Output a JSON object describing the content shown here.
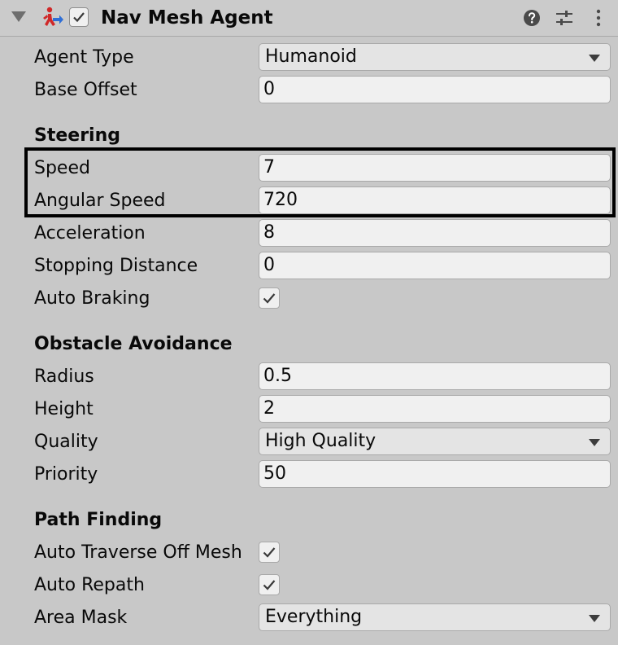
{
  "component": {
    "title": "Nav Mesh Agent",
    "enabled": true,
    "icons": [
      "foldout-arrow-icon",
      "nav-agent-icon",
      "help-icon",
      "preset-icon",
      "kebab-menu-icon"
    ]
  },
  "fields": {
    "agent_type": {
      "label": "Agent Type",
      "value": "Humanoid"
    },
    "base_offset": {
      "label": "Base Offset",
      "value": "0"
    }
  },
  "steering": {
    "title": "Steering",
    "speed": {
      "label": "Speed",
      "value": "7"
    },
    "angular_speed": {
      "label": "Angular Speed",
      "value": "720"
    },
    "acceleration": {
      "label": "Acceleration",
      "value": "8"
    },
    "stopping_distance": {
      "label": "Stopping Distance",
      "value": "0"
    },
    "auto_braking": {
      "label": "Auto Braking",
      "checked": true
    }
  },
  "obstacle_avoidance": {
    "title": "Obstacle Avoidance",
    "radius": {
      "label": "Radius",
      "value": "0.5"
    },
    "height": {
      "label": "Height",
      "value": "2"
    },
    "quality": {
      "label": "Quality",
      "value": "High Quality"
    },
    "priority": {
      "label": "Priority",
      "value": "50"
    }
  },
  "path_finding": {
    "title": "Path Finding",
    "auto_traverse": {
      "label": "Auto Traverse Off Mesh",
      "checked": true
    },
    "auto_repath": {
      "label": "Auto Repath",
      "checked": true
    },
    "area_mask": {
      "label": "Area Mask",
      "value": "Everything"
    }
  },
  "colors": {
    "background": "#c8c8c8",
    "field": "#f0f0f0",
    "highlight_border": "#000000",
    "agent_icon_red": "#d02828",
    "agent_icon_blue": "#2f6fd6"
  }
}
